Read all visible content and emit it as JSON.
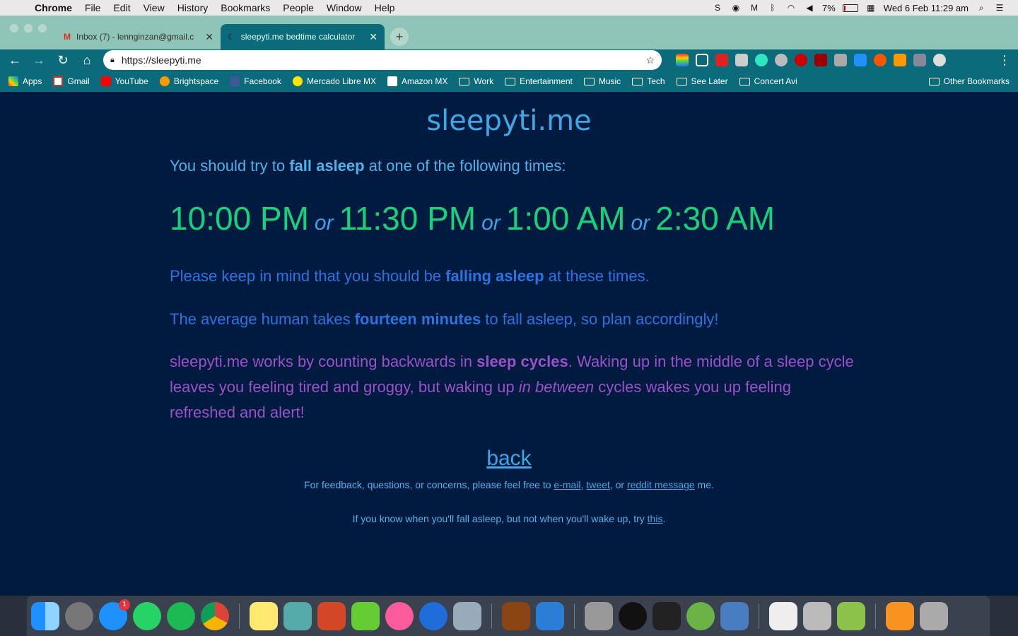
{
  "menubar": {
    "app": "Chrome",
    "items": [
      "File",
      "Edit",
      "View",
      "History",
      "Bookmarks",
      "People",
      "Window",
      "Help"
    ],
    "battery": "7%",
    "datetime": "Wed 6 Feb  11:29 am"
  },
  "tabs": [
    {
      "title": "Inbox (7) - lennginzan@gmail.c",
      "icon": "gmail-icon"
    },
    {
      "title": "sleepyti.me bedtime calculator",
      "icon": "moon-icon"
    }
  ],
  "toolbar": {
    "url": "https://sleepyti.me"
  },
  "bookmarks": {
    "items": [
      "Apps",
      "Gmail",
      "YouTube",
      "Brightspace",
      "Facebook",
      "Mercado Libre MX",
      "Amazon MX",
      "Work",
      "Entertainment",
      "Music",
      "Tech",
      "See Later",
      "Concert Avi"
    ],
    "other": "Other Bookmarks"
  },
  "page": {
    "title": "sleepyti.me",
    "intro_pre": "You should try to ",
    "intro_bold": "fall asleep",
    "intro_post": " at one of the following times:",
    "times": [
      "10:00 PM",
      "11:30 PM",
      "1:00 AM",
      "2:30 AM"
    ],
    "or_word": "or",
    "note1_pre": "Please keep in mind that you should be ",
    "note1_bold": "falling asleep",
    "note1_post": " at these times.",
    "note2_pre": "The average human takes ",
    "note2_bold": "fourteen minutes",
    "note2_post": " to fall asleep, so plan accordingly!",
    "note3_pre": "sleepyti.me works by counting backwards in ",
    "note3_bold": "sleep cycles",
    "note3_mid": ". Waking up in the middle of a sleep cycle leaves you feeling tired and groggy, but waking up ",
    "note3_em": "in between",
    "note3_post": " cycles wakes you up feeling refreshed and alert!",
    "back": "back",
    "feedback_pre": "For feedback, questions, or concerns, please feel free to ",
    "email": "e-mail",
    "tweet": "tweet",
    "reddit": "reddit message",
    "feedback_post": " me.",
    "try_pre": "If you know when you'll fall asleep, but not when you'll wake up, try ",
    "try_link": "this",
    "try_post": "."
  },
  "dock": {
    "badge": "1"
  },
  "colors": {
    "page_bg": "#001a40",
    "time_green": "#17d27b",
    "title_blue": "#3da8e5",
    "note_blue": "#2b73e0",
    "note_purple": "#9b51c8"
  }
}
